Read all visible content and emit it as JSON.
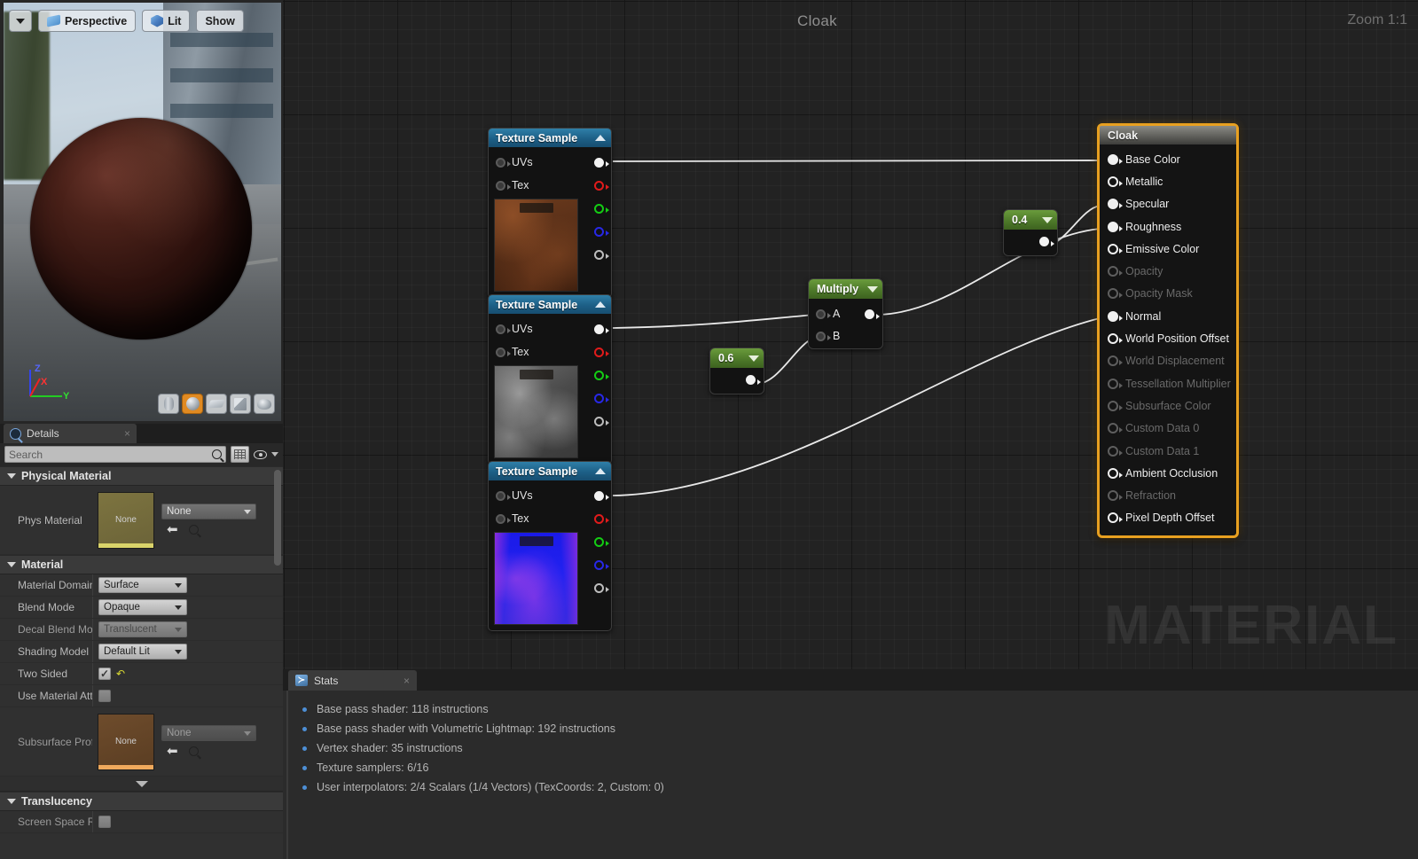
{
  "viewport": {
    "toolbar": {
      "menu_arrow": "dropdown-arrow",
      "perspective_label": "Perspective",
      "lit_label": "Lit",
      "show_label": "Show"
    },
    "gizmo": {
      "x": "X",
      "y": "Y",
      "z": "Z"
    },
    "shapes": [
      {
        "name": "cylinder",
        "selected": false
      },
      {
        "name": "sphere",
        "selected": true
      },
      {
        "name": "plane",
        "selected": false
      },
      {
        "name": "cube",
        "selected": false
      },
      {
        "name": "teapot",
        "selected": false
      }
    ]
  },
  "details": {
    "tab_label": "Details",
    "close": "×",
    "search_placeholder": "Search",
    "search_value": "",
    "categories": {
      "physical_material": {
        "title": "Physical Material",
        "phys_material": {
          "label": "Phys Material",
          "thumb_text": "None",
          "combo_value": "None"
        }
      },
      "material": {
        "title": "Material",
        "rows": [
          {
            "label": "Material Domain",
            "value": "Surface",
            "type": "combo",
            "disabled": false
          },
          {
            "label": "Blend Mode",
            "value": "Opaque",
            "type": "combo",
            "disabled": false
          },
          {
            "label": "Decal Blend Mode",
            "value": "Translucent",
            "type": "combo",
            "disabled": true
          },
          {
            "label": "Shading Model",
            "value": "Default Lit",
            "type": "combo",
            "disabled": false
          },
          {
            "label": "Two Sided",
            "value": "checked",
            "type": "checkbox",
            "disabled": false
          },
          {
            "label": "Use Material Attri",
            "value": "unchecked",
            "type": "checkbox",
            "disabled": true
          }
        ],
        "subsurface_profile": {
          "label": "Subsurface Profil",
          "thumb_text": "None",
          "combo_value": "None"
        }
      },
      "translucency": {
        "title": "Translucency",
        "rows": [
          {
            "label": "Screen Space Ref",
            "value": "unchecked",
            "type": "checkbox",
            "disabled": true
          }
        ]
      }
    }
  },
  "graph": {
    "title": "Cloak",
    "zoom": "Zoom 1:1",
    "watermark": "MATERIAL",
    "nodes": {
      "texture_samples": [
        {
          "title": "Texture Sample",
          "inputs": [
            {
              "label": "UVs",
              "connected": false
            },
            {
              "label": "Tex",
              "connected": false
            }
          ],
          "outputs": [
            {
              "channel": "RGB",
              "color": "#f2f2f2",
              "connected": true
            },
            {
              "channel": "R",
              "color": "#e01b1b",
              "connected": false
            },
            {
              "channel": "G",
              "color": "#14cc14",
              "connected": false
            },
            {
              "channel": "B",
              "color": "#2828e6",
              "connected": false
            },
            {
              "channel": "A",
              "color": "#bdbdbd",
              "connected": false
            }
          ],
          "thumbnail": "albedo-texture"
        },
        {
          "title": "Texture Sample",
          "inputs": [
            {
              "label": "UVs",
              "connected": false
            },
            {
              "label": "Tex",
              "connected": false
            }
          ],
          "outputs": [
            {
              "channel": "RGB",
              "color": "#f2f2f2",
              "connected": true
            },
            {
              "channel": "R",
              "color": "#e01b1b",
              "connected": false
            },
            {
              "channel": "G",
              "color": "#14cc14",
              "connected": false
            },
            {
              "channel": "B",
              "color": "#2828e6",
              "connected": false
            },
            {
              "channel": "A",
              "color": "#bdbdbd",
              "connected": false
            }
          ],
          "thumbnail": "roughness-texture"
        },
        {
          "title": "Texture Sample",
          "inputs": [
            {
              "label": "UVs",
              "connected": false
            },
            {
              "label": "Tex",
              "connected": false
            }
          ],
          "outputs": [
            {
              "channel": "RGB",
              "color": "#f2f2f2",
              "connected": true
            },
            {
              "channel": "R",
              "color": "#e01b1b",
              "connected": false
            },
            {
              "channel": "G",
              "color": "#14cc14",
              "connected": false
            },
            {
              "channel": "B",
              "color": "#2828e6",
              "connected": false
            },
            {
              "channel": "A",
              "color": "#bdbdbd",
              "connected": false
            }
          ],
          "thumbnail": "normal-map-texture"
        }
      ],
      "scalars": [
        {
          "value": "0.6"
        },
        {
          "value": "0.4"
        }
      ],
      "multiply": {
        "title": "Multiply",
        "input_a": "A",
        "input_b": "B"
      },
      "material_output": {
        "title": "Cloak",
        "pins": [
          {
            "label": "Base Color",
            "enabled": true,
            "connected": true
          },
          {
            "label": "Metallic",
            "enabled": true,
            "connected": false
          },
          {
            "label": "Specular",
            "enabled": true,
            "connected": true
          },
          {
            "label": "Roughness",
            "enabled": true,
            "connected": true
          },
          {
            "label": "Emissive Color",
            "enabled": true,
            "connected": false
          },
          {
            "label": "Opacity",
            "enabled": false,
            "connected": false
          },
          {
            "label": "Opacity Mask",
            "enabled": false,
            "connected": false
          },
          {
            "label": "Normal",
            "enabled": true,
            "connected": true
          },
          {
            "label": "World Position Offset",
            "enabled": true,
            "connected": false
          },
          {
            "label": "World Displacement",
            "enabled": false,
            "connected": false
          },
          {
            "label": "Tessellation Multiplier",
            "enabled": false,
            "connected": false
          },
          {
            "label": "Subsurface Color",
            "enabled": false,
            "connected": false
          },
          {
            "label": "Custom Data 0",
            "enabled": false,
            "connected": false
          },
          {
            "label": "Custom Data 1",
            "enabled": false,
            "connected": false
          },
          {
            "label": "Ambient Occlusion",
            "enabled": true,
            "connected": false
          },
          {
            "label": "Refraction",
            "enabled": false,
            "connected": false
          },
          {
            "label": "Pixel Depth Offset",
            "enabled": true,
            "connected": false
          }
        ]
      }
    }
  },
  "stats": {
    "tab_label": "Stats",
    "close": "×",
    "lines": [
      "Base pass shader: 118 instructions",
      "Base pass shader with Volumetric Lightmap: 192 instructions",
      "Vertex shader: 35 instructions",
      "Texture samplers: 6/16",
      "User interpolators: 2/4 Scalars (1/4 Vectors) (TexCoords: 2, Custom: 0)"
    ]
  },
  "colors": {
    "accent_orange": "#e8a020",
    "node_blue": "#1d5f86",
    "node_green": "#4e7a2a",
    "graph_bg": "#222222"
  }
}
